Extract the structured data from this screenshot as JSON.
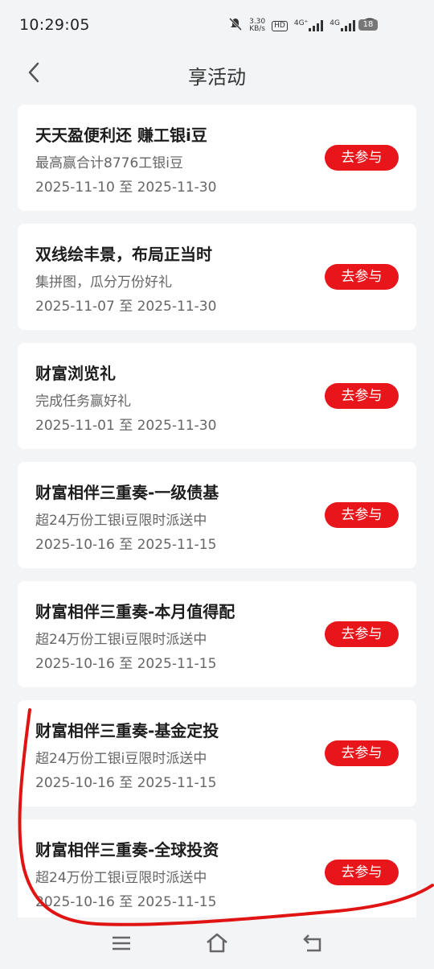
{
  "status": {
    "time": "10:29:05",
    "net_speed": "3.30",
    "net_unit": "KB/s",
    "hd_label": "HD",
    "signal_1": "4G⁺",
    "signal_2": "4G",
    "battery": "18",
    "icons": [
      "mute-icon",
      "hd-icon",
      "signal-icon",
      "signal-icon",
      "wifi-icon",
      "battery-icon"
    ]
  },
  "header": {
    "title": "享活动",
    "back_icon": "chevron-left-icon"
  },
  "activities": [
    {
      "title": "天天盈便利还 赚工银i豆",
      "subtitle": "最高赢合计8776工银i豆",
      "date": "2025-11-10 至 2025-11-30",
      "button": "去参与"
    },
    {
      "title": "双线绘丰景，布局正当时",
      "subtitle": "集拼图，瓜分万份好礼",
      "date": "2025-11-07 至 2025-11-30",
      "button": "去参与"
    },
    {
      "title": "财富浏览礼",
      "subtitle": "完成任务赢好礼",
      "date": "2025-11-01 至 2025-11-30",
      "button": "去参与"
    },
    {
      "title": "财富相伴三重奏-一级债基",
      "subtitle": "超24万份工银i豆限时派送中",
      "date": "2025-10-16 至 2025-11-15",
      "button": "去参与"
    },
    {
      "title": "财富相伴三重奏-本月值得配",
      "subtitle": "超24万份工银i豆限时派送中",
      "date": "2025-10-16 至 2025-11-15",
      "button": "去参与"
    },
    {
      "title": "财富相伴三重奏-基金定投",
      "subtitle": "超24万份工银i豆限时派送中",
      "date": "2025-10-16 至 2025-11-15",
      "button": "去参与"
    },
    {
      "title": "财富相伴三重奏-全球投资",
      "subtitle": "超24万份工银i豆限时派送中",
      "date": "2025-10-16 至 2025-11-15",
      "button": "去参与"
    }
  ],
  "navbar": {
    "icons": [
      "menu-icon",
      "home-icon",
      "back-icon"
    ]
  },
  "colors": {
    "accent": "#e8161b",
    "annotation": "#e11414",
    "background": "#f3f4f6"
  }
}
